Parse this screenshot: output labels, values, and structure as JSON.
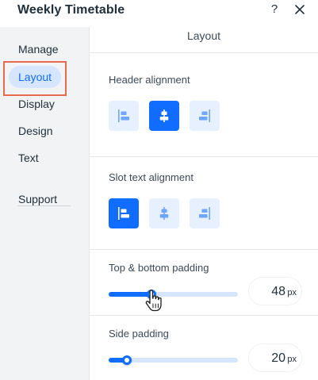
{
  "header": {
    "title": "Weekly Timetable",
    "help_label": "?"
  },
  "sidebar": {
    "items": [
      {
        "label": "Manage"
      },
      {
        "label": "Layout"
      },
      {
        "label": "Display"
      },
      {
        "label": "Design"
      },
      {
        "label": "Text"
      },
      {
        "label": "Support"
      }
    ],
    "active": "Layout"
  },
  "main": {
    "panel_title": "Layout",
    "header_alignment": {
      "label": "Header alignment",
      "options": [
        "align-left-icon",
        "align-center-icon",
        "align-right-icon"
      ],
      "selected": "center"
    },
    "slot_text_alignment": {
      "label": "Slot text alignment",
      "options": [
        "align-left-icon",
        "align-center-icon",
        "align-right-icon"
      ],
      "selected": "left"
    },
    "top_bottom_padding": {
      "label": "Top & bottom padding",
      "value": "48",
      "unit": "px",
      "fill_fraction": 0.33
    },
    "side_padding": {
      "label": "Side padding",
      "value": "20",
      "unit": "px",
      "fill_fraction": 0.14
    }
  },
  "colors": {
    "accent": "#116dff",
    "accent_light": "#d6e6fe",
    "highlight_box": "#e86a4f"
  }
}
